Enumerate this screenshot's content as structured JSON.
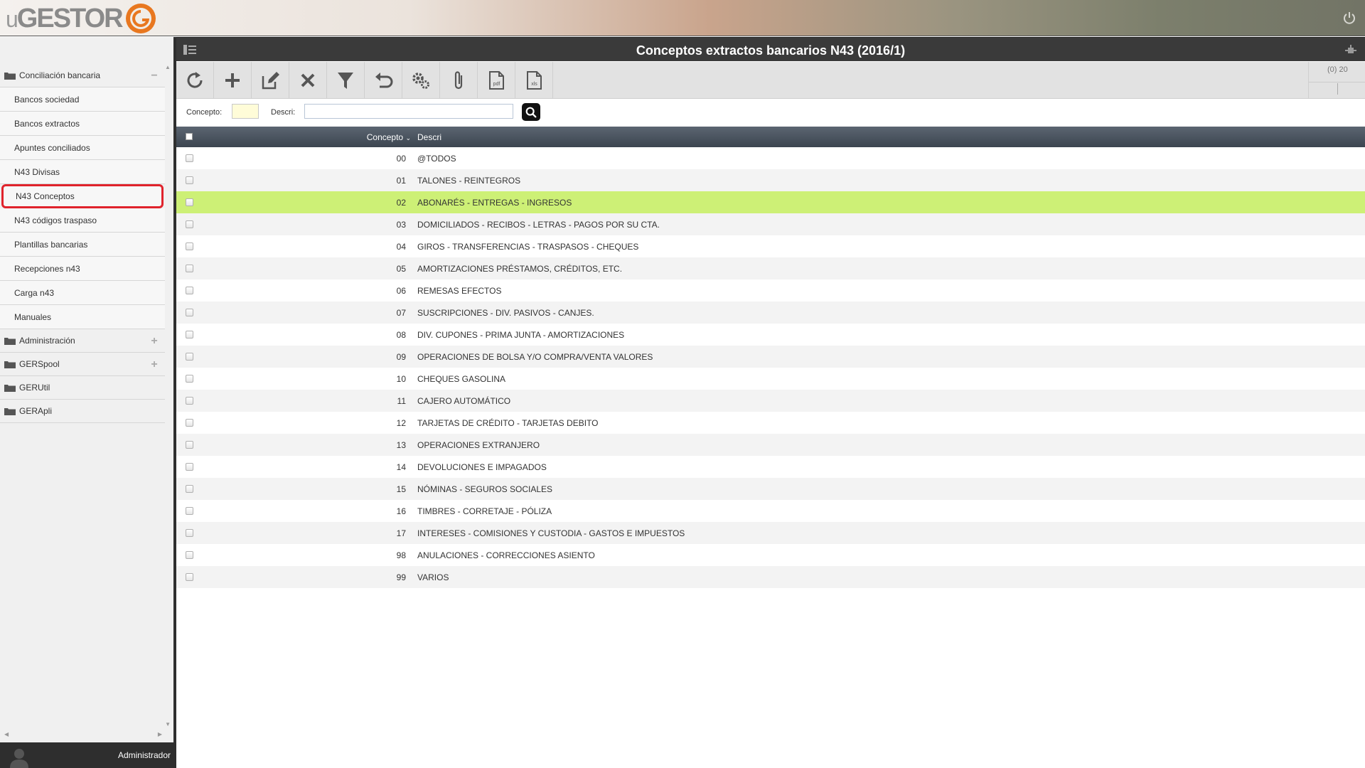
{
  "app": {
    "logo_text_prefix": "u",
    "logo_text_main": "GESTOR"
  },
  "sidebar": {
    "groups": [
      {
        "label": "Conciliación bancaria",
        "toggle": "−",
        "expanded": true
      },
      {
        "label": "Administración",
        "toggle": "+"
      },
      {
        "label": "GERSpool",
        "toggle": "+"
      },
      {
        "label": "GERUtil",
        "toggle": ""
      },
      {
        "label": "GERApli",
        "toggle": ""
      }
    ],
    "items": [
      {
        "label": "Bancos sociedad"
      },
      {
        "label": "Bancos extractos"
      },
      {
        "label": "Apuntes conciliados"
      },
      {
        "label": "N43 Divisas"
      },
      {
        "label": "N43 Conceptos",
        "active": true
      },
      {
        "label": "N43 códigos traspaso"
      },
      {
        "label": "Plantillas bancarias"
      },
      {
        "label": "Recepciones n43"
      },
      {
        "label": "Carga n43"
      },
      {
        "label": "Manuales"
      }
    ],
    "user": "Administrador"
  },
  "main": {
    "title": "Conceptos extractos bancarios N43 (2016/1)",
    "pager": "(0) 20",
    "toolbar": [
      {
        "icon": "refresh-icon"
      },
      {
        "icon": "add-icon"
      },
      {
        "icon": "edit-icon"
      },
      {
        "icon": "delete-icon"
      },
      {
        "icon": "filter-icon"
      },
      {
        "icon": "undo-icon"
      },
      {
        "icon": "settings-icon"
      },
      {
        "icon": "attachment-icon"
      },
      {
        "icon": "pdf-icon",
        "label": "pdf"
      },
      {
        "icon": "xls-icon",
        "label": "xls"
      }
    ],
    "filters": {
      "concepto_label": "Concepto:",
      "concepto_value": "",
      "descri_label": "Descri:",
      "descri_value": ""
    },
    "columns": {
      "concepto": "Concepto",
      "descri": "Descri"
    },
    "colors": {
      "selected_row": "#cdf076",
      "active_outline": "#e0232c"
    }
  },
  "rows": [
    {
      "code": "00",
      "desc": "@TODOS"
    },
    {
      "code": "01",
      "desc": "TALONES - REINTEGROS"
    },
    {
      "code": "02",
      "desc": "ABONARÉS - ENTREGAS - INGRESOS",
      "selected": true
    },
    {
      "code": "03",
      "desc": "DOMICILIADOS - RECIBOS - LETRAS - PAGOS POR SU CTA."
    },
    {
      "code": "04",
      "desc": "GIROS - TRANSFERENCIAS - TRASPASOS - CHEQUES"
    },
    {
      "code": "05",
      "desc": "AMORTIZACIONES PRÉSTAMOS, CRÉDITOS, ETC."
    },
    {
      "code": "06",
      "desc": "REMESAS EFECTOS"
    },
    {
      "code": "07",
      "desc": "SUSCRIPCIONES - DIV. PASIVOS - CANJES."
    },
    {
      "code": "08",
      "desc": "DIV. CUPONES - PRIMA JUNTA - AMORTIZACIONES"
    },
    {
      "code": "09",
      "desc": "OPERACIONES DE BOLSA Y/O COMPRA/VENTA VALORES"
    },
    {
      "code": "10",
      "desc": "CHEQUES GASOLINA"
    },
    {
      "code": "11",
      "desc": "CAJERO AUTOMÁTICO"
    },
    {
      "code": "12",
      "desc": "TARJETAS DE CRÉDITO - TARJETAS DEBITO"
    },
    {
      "code": "13",
      "desc": "OPERACIONES EXTRANJERO"
    },
    {
      "code": "14",
      "desc": "DEVOLUCIONES E IMPAGADOS"
    },
    {
      "code": "15",
      "desc": "NÓMINAS - SEGUROS SOCIALES"
    },
    {
      "code": "16",
      "desc": "TIMBRES - CORRETAJE - PÓLIZA"
    },
    {
      "code": "17",
      "desc": "INTERESES - COMISIONES Y CUSTODIA - GASTOS E IMPUESTOS"
    },
    {
      "code": "98",
      "desc": "ANULACIONES - CORRECCIONES ASIENTO"
    },
    {
      "code": "99",
      "desc": "VARIOS"
    }
  ]
}
